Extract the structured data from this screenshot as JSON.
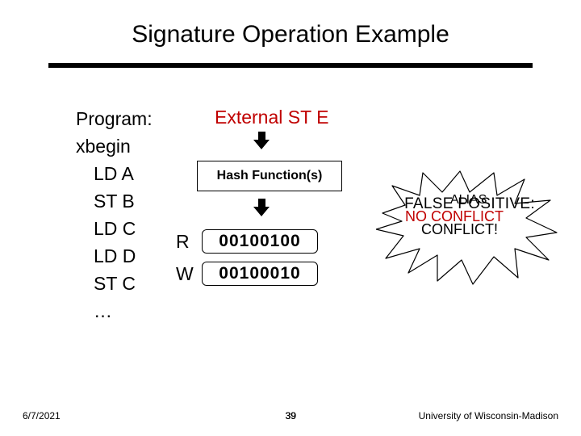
{
  "title": "Signature Operation Example",
  "program": {
    "header": "Program:",
    "lines": [
      "xbegin",
      "LD A",
      "ST B",
      "LD C",
      "LD D",
      "ST C",
      "…"
    ]
  },
  "external_event": "External ST E",
  "hash_label": "Hash Function(s)",
  "registers": {
    "r": {
      "label": "R",
      "bits": "00100100"
    },
    "w": {
      "label": "W",
      "bits": "00100010"
    }
  },
  "burst": {
    "false_positive": "FALSE POSITIVE:",
    "alias": "ALIAS",
    "no_conflict": "NO CONFLICT",
    "conflict": "CONFLICT!"
  },
  "footer": {
    "date": "6/7/2021",
    "page": "39",
    "affiliation": "University of Wisconsin-Madison"
  }
}
